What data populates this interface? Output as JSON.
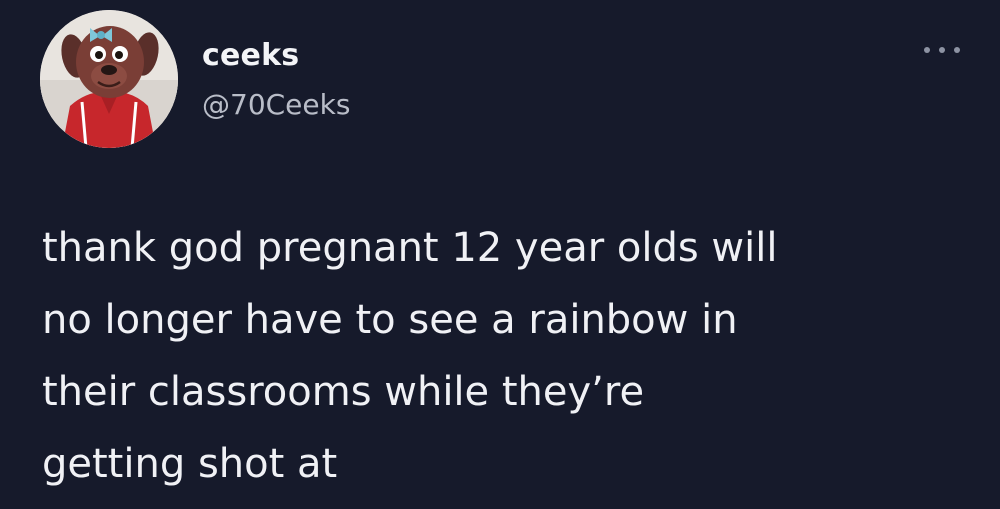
{
  "tweet": {
    "display_name": "ceeks",
    "handle": "@70Ceeks",
    "more_icon": "more-horizontal-icon",
    "lines": [
      "thank god pregnant 12 year olds will",
      "no longer have to see a rainbow in",
      "their classrooms while they’re",
      "getting shot at"
    ]
  },
  "colors": {
    "background": "#161a2b",
    "text": "#f0f1f5",
    "handle": "#b9bdc8",
    "muted_icon": "#8d93a3"
  }
}
